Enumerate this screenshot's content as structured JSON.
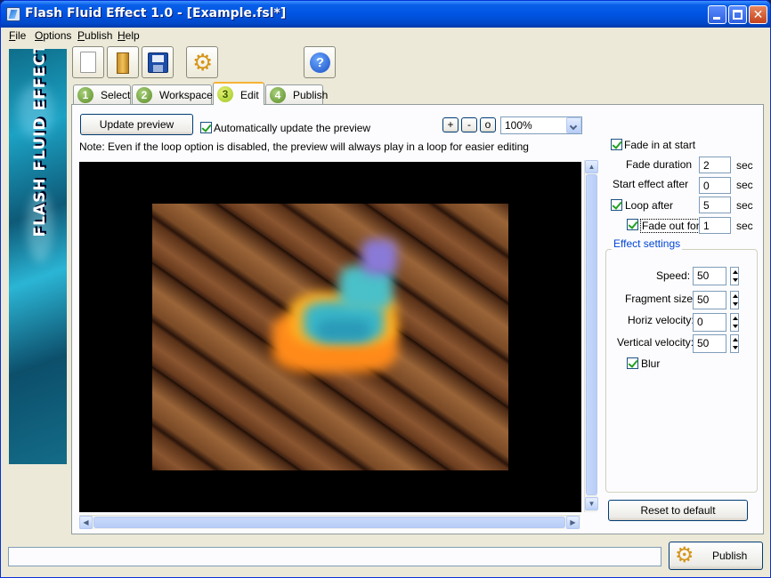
{
  "window": {
    "title": "Flash Fluid Effect 1.0 - [Example.fsl*]"
  },
  "menu": [
    {
      "label": "File",
      "u": "F",
      "rest": "ile"
    },
    {
      "label": "Options",
      "u": "O",
      "rest": "ptions"
    },
    {
      "label": "Publish",
      "u": "P",
      "rest": "ublish"
    },
    {
      "label": "Help",
      "u": "H",
      "rest": "elp"
    }
  ],
  "banner": {
    "text": "FLASH FLUID EFFECT"
  },
  "tabs": [
    {
      "num": "1",
      "label": "Select"
    },
    {
      "num": "2",
      "label": "Workspace"
    },
    {
      "num": "3",
      "label": "Edit"
    },
    {
      "num": "4",
      "label": "Publish"
    }
  ],
  "edit": {
    "update_preview": "Update preview",
    "auto_update": "Automatically update the preview",
    "zoom_plus": "+",
    "zoom_minus": "-",
    "zoom_reset": "o",
    "zoom_value": "100%",
    "note": "Note: Even if the loop option is disabled, the preview will always play in a loop for easier editing"
  },
  "settings": {
    "fade_in": "Fade in at start",
    "fade_duration_label": "Fade duration",
    "fade_duration": "2",
    "start_after_label": "Start effect after",
    "start_after": "0",
    "loop_after_label": "Loop after",
    "loop_after": "5",
    "fade_out_label": "Fade out for",
    "fade_out": "1",
    "unit": "sec",
    "group_title": "Effect settings",
    "speed_label": "Speed:",
    "speed": "50",
    "fragment_label": "Fragment size:",
    "fragment": "50",
    "horiz_label": "Horiz velocity:",
    "horiz": "0",
    "vertical_label": "Vertical velocity:",
    "vertical": "50",
    "blur_label": "Blur",
    "reset": "Reset to default"
  },
  "footer": {
    "publish": "Publish"
  },
  "colors": {
    "accent": "#0054e3",
    "tab_highlight": "#f7b333",
    "group_title": "#0046d5"
  }
}
